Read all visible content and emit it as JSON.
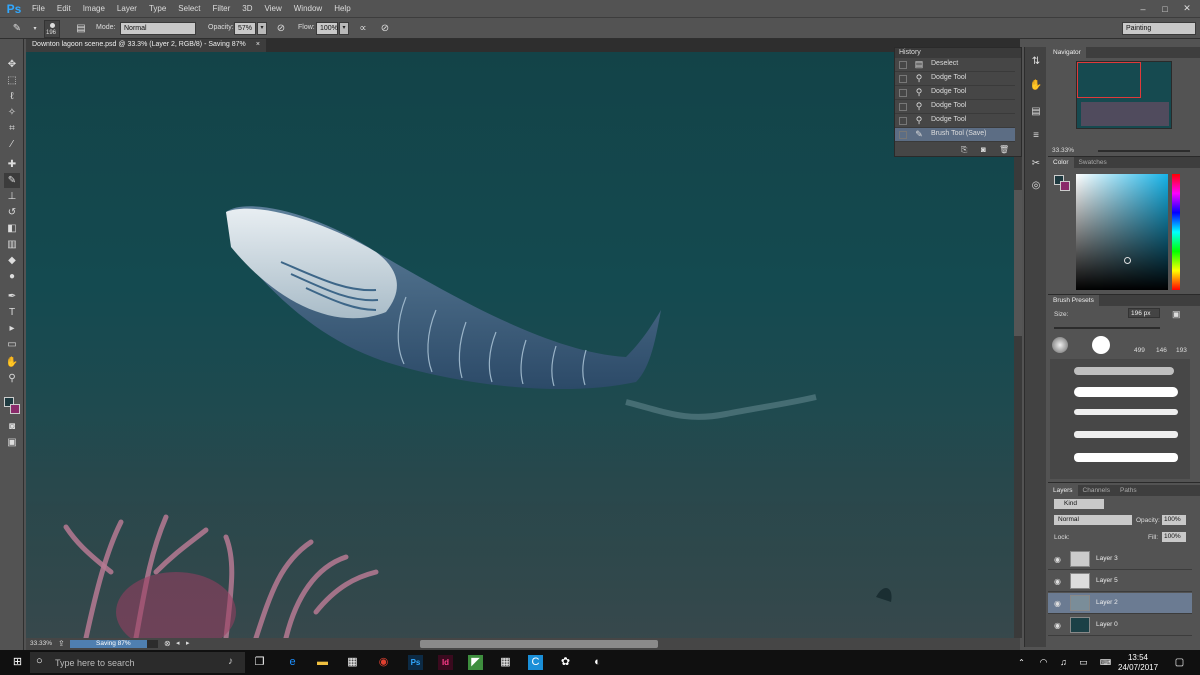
{
  "app": {
    "logo": "Ps"
  },
  "menu": [
    "File",
    "Edit",
    "Image",
    "Layer",
    "Type",
    "Select",
    "Filter",
    "3D",
    "View",
    "Window",
    "Help"
  ],
  "window_controls": {
    "minimize": "–",
    "maximize": "□",
    "close": "✕"
  },
  "options": {
    "brush_size": "196",
    "mode_label": "Mode:",
    "mode_value": "Normal",
    "opacity_label": "Opacity:",
    "opacity_value": "57%",
    "flow_label": "Flow:",
    "flow_value": "100%",
    "workspace": "Painting"
  },
  "document": {
    "tab_title": "Downton lagoon scene.psd @ 33.3% (Layer 2, RGB/8) - Saving 87%",
    "close": "×"
  },
  "history": {
    "title": "History",
    "items": [
      {
        "label": "Deselect",
        "icon": "document-icon"
      },
      {
        "label": "Dodge Tool",
        "icon": "dodge-icon"
      },
      {
        "label": "Dodge Tool",
        "icon": "dodge-icon"
      },
      {
        "label": "Dodge Tool",
        "icon": "dodge-icon"
      },
      {
        "label": "Dodge Tool",
        "icon": "dodge-icon"
      },
      {
        "label": "Brush Tool (Save)",
        "icon": "brush-icon",
        "active": true
      }
    ]
  },
  "navigator": {
    "title": "Navigator",
    "zoom": "33.33%"
  },
  "color": {
    "tab_color": "Color",
    "tab_swatches": "Swatches",
    "fg": "#1e3a40",
    "bg": "#8a2a6a"
  },
  "brush_presets": {
    "title": "Brush Presets",
    "size_label": "Size:",
    "size_value": "196 px",
    "tips": [
      "499",
      "146",
      "193"
    ]
  },
  "layers": {
    "tabs": [
      "Layers",
      "Channels",
      "Paths"
    ],
    "filter": "Kind",
    "blend": "Normal",
    "opacity_label": "Opacity:",
    "opacity_value": "100%",
    "lock_label": "Lock:",
    "fill_label": "Fill:",
    "fill_value": "100%",
    "items": [
      {
        "name": "Layer 3",
        "selected": false
      },
      {
        "name": "Layer 5",
        "selected": false
      },
      {
        "name": "Layer 2",
        "selected": true
      },
      {
        "name": "Layer 0",
        "selected": false
      }
    ]
  },
  "status": {
    "zoom": "33.33%",
    "progress_text": "Saving 87%",
    "progress": 0.87
  },
  "taskbar": {
    "search_placeholder": "Type here to search",
    "time": "13:54",
    "date": "24/07/2017"
  }
}
